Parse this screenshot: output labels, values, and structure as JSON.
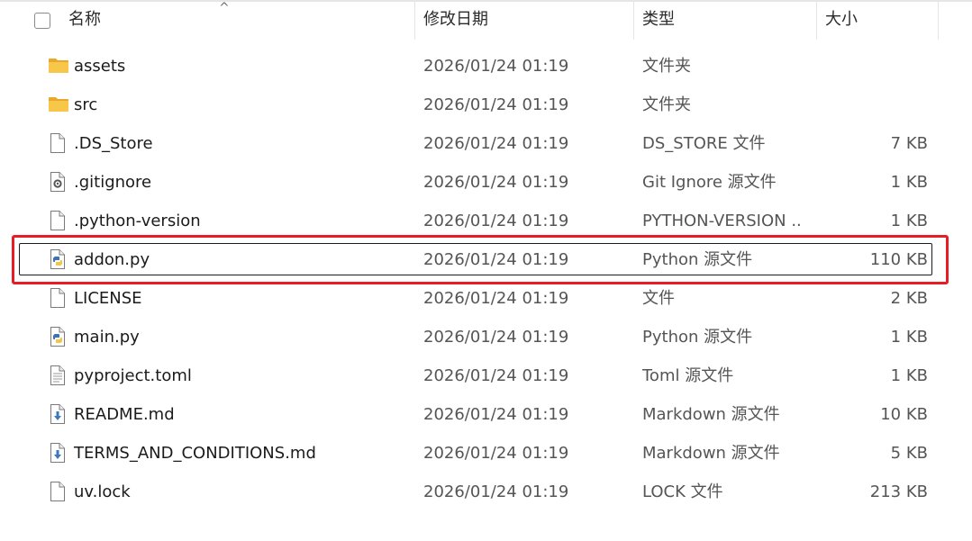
{
  "header": {
    "name_label": "名称",
    "date_label": "修改日期",
    "type_label": "类型",
    "size_label": "大小",
    "sort_indicator": "^"
  },
  "files": [
    {
      "name": "assets",
      "date": "2026/01/24 01:19",
      "type": "文件夹",
      "size": "",
      "icon": "folder-icon"
    },
    {
      "name": "src",
      "date": "2026/01/24 01:19",
      "type": "文件夹",
      "size": "",
      "icon": "folder-icon"
    },
    {
      "name": ".DS_Store",
      "date": "2026/01/24 01:19",
      "type": "DS_STORE 文件",
      "size": "7 KB",
      "icon": "file-icon"
    },
    {
      "name": ".gitignore",
      "date": "2026/01/24 01:19",
      "type": "Git Ignore 源文件",
      "size": "1 KB",
      "icon": "settings-file-icon"
    },
    {
      "name": ".python-version",
      "date": "2026/01/24 01:19",
      "type": "PYTHON-VERSION ...",
      "size": "1 KB",
      "icon": "file-icon"
    },
    {
      "name": "addon.py",
      "date": "2026/01/24 01:19",
      "type": "Python 源文件",
      "size": "110 KB",
      "icon": "python-file-icon",
      "selected": true
    },
    {
      "name": "LICENSE",
      "date": "2026/01/24 01:19",
      "type": "文件",
      "size": "2 KB",
      "icon": "file-icon"
    },
    {
      "name": "main.py",
      "date": "2026/01/24 01:19",
      "type": "Python 源文件",
      "size": "1 KB",
      "icon": "python-file-icon"
    },
    {
      "name": "pyproject.toml",
      "date": "2026/01/24 01:19",
      "type": "Toml 源文件",
      "size": "1 KB",
      "icon": "text-file-icon"
    },
    {
      "name": "README.md",
      "date": "2026/01/24 01:19",
      "type": "Markdown 源文件",
      "size": "10 KB",
      "icon": "markdown-file-icon"
    },
    {
      "name": "TERMS_AND_CONDITIONS.md",
      "date": "2026/01/24 01:19",
      "type": "Markdown 源文件",
      "size": "5 KB",
      "icon": "markdown-file-icon"
    },
    {
      "name": "uv.lock",
      "date": "2026/01/24 01:19",
      "type": "LOCK 文件",
      "size": "213 KB",
      "icon": "file-icon"
    }
  ],
  "colors": {
    "folder": "#f8c74a",
    "highlight": "#e81c24",
    "python_blue": "#3b74b5",
    "python_yellow": "#f2c744",
    "markdown_blue": "#3a78c2"
  }
}
